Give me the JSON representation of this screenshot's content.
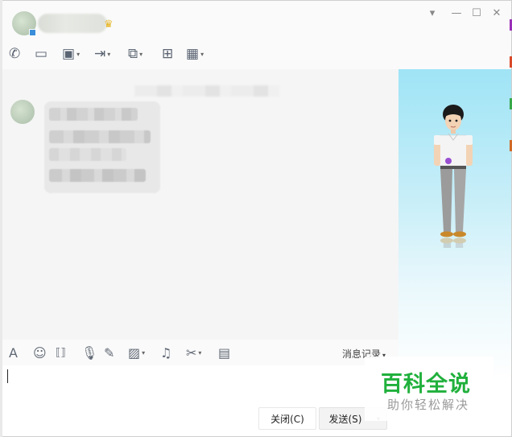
{
  "window": {
    "controls": {
      "skin": "▾",
      "minimize": "—",
      "maximize": "☐",
      "close": "✕"
    }
  },
  "header": {
    "contact_icon": "vip-crown-icon",
    "tools": [
      {
        "name": "voice-call-icon",
        "glyph": "✆",
        "has_menu": false
      },
      {
        "name": "video-call-icon",
        "glyph": "▭",
        "has_menu": false
      },
      {
        "name": "remote-demo-icon",
        "glyph": "▣",
        "has_menu": true
      },
      {
        "name": "send-file-icon",
        "glyph": "⇥",
        "has_menu": true
      },
      {
        "name": "remote-desktop-icon",
        "glyph": "⧉",
        "has_menu": true
      },
      {
        "name": "create-group-icon",
        "glyph": "⊞",
        "has_menu": false
      },
      {
        "name": "apps-icon",
        "glyph": "▦",
        "has_menu": true
      }
    ]
  },
  "input_toolbar": {
    "tools": [
      {
        "name": "font-icon",
        "glyph": "A",
        "has_menu": false
      },
      {
        "name": "emoji-icon",
        "glyph": "☺",
        "has_menu": false
      },
      {
        "name": "shake-icon",
        "glyph": "⟦⟧",
        "has_menu": false
      },
      {
        "name": "voice-message-icon",
        "glyph": "🎙",
        "has_menu": false
      },
      {
        "name": "doodle-icon",
        "glyph": "✎",
        "has_menu": false
      },
      {
        "name": "image-icon",
        "glyph": "▨",
        "has_menu": true
      },
      {
        "name": "music-icon",
        "glyph": "♫",
        "has_menu": false
      },
      {
        "name": "screenshot-icon",
        "glyph": "✂",
        "has_menu": true
      },
      {
        "name": "red-packet-icon",
        "glyph": "▤",
        "has_menu": false
      }
    ],
    "history_label": "消息记录",
    "history_caret": "▾"
  },
  "footer": {
    "close_label": "关闭(C)",
    "send_label": "发送(S)",
    "send_caret": "▾"
  },
  "watermark": {
    "title": "百科全说",
    "subtitle": "助你轻松解决"
  },
  "colors": {
    "accent_green": "#20b03c",
    "side_pane_top": "#9fe4f6",
    "icon_gray": "#5a6472"
  }
}
